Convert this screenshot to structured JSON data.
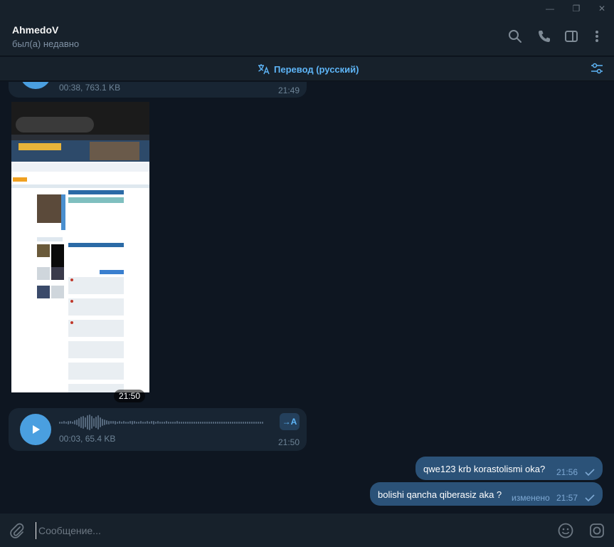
{
  "window": {
    "minimize": "—",
    "restore": "❐",
    "close": "✕"
  },
  "chat_header": {
    "name": "AhmedoV",
    "status": "был(а) недавно"
  },
  "translate_bar": {
    "label": "Перевод (русский)"
  },
  "messages": [
    {
      "type": "voice",
      "direction": "in",
      "meta": "00:38, 763.1 KB",
      "time": "21:49"
    },
    {
      "type": "photo",
      "direction": "in",
      "time": "21:50"
    },
    {
      "type": "voice",
      "direction": "in",
      "meta": "00:03, 65.4 KB",
      "time": "21:50",
      "transcribe_label": "→A"
    },
    {
      "type": "text",
      "direction": "out",
      "text": "qwe123 krb korastolismi oka?",
      "time": "21:56"
    },
    {
      "type": "text",
      "direction": "out",
      "text": "bolishi qancha qiberasiz aka ?",
      "edited": "изменено",
      "time": "21:57"
    }
  ],
  "photo_content": {
    "phone_time": "21:50",
    "url": "iccup.com/profile/v",
    "tab_count": "6",
    "banner_text": "INTERNATIONAL DOTA CUP",
    "headline": "Скоро новый сезон, успей набрать свой лучший Pont'з Ладдер Бонуса",
    "profile_name": "U2B"
  },
  "composer": {
    "placeholder": "Сообщение..."
  },
  "colors": {
    "background": "#0e1621",
    "panel": "#17212b",
    "bubble_in": "#182533",
    "bubble_out": "#2b5278",
    "accent": "#5eb5f7"
  }
}
